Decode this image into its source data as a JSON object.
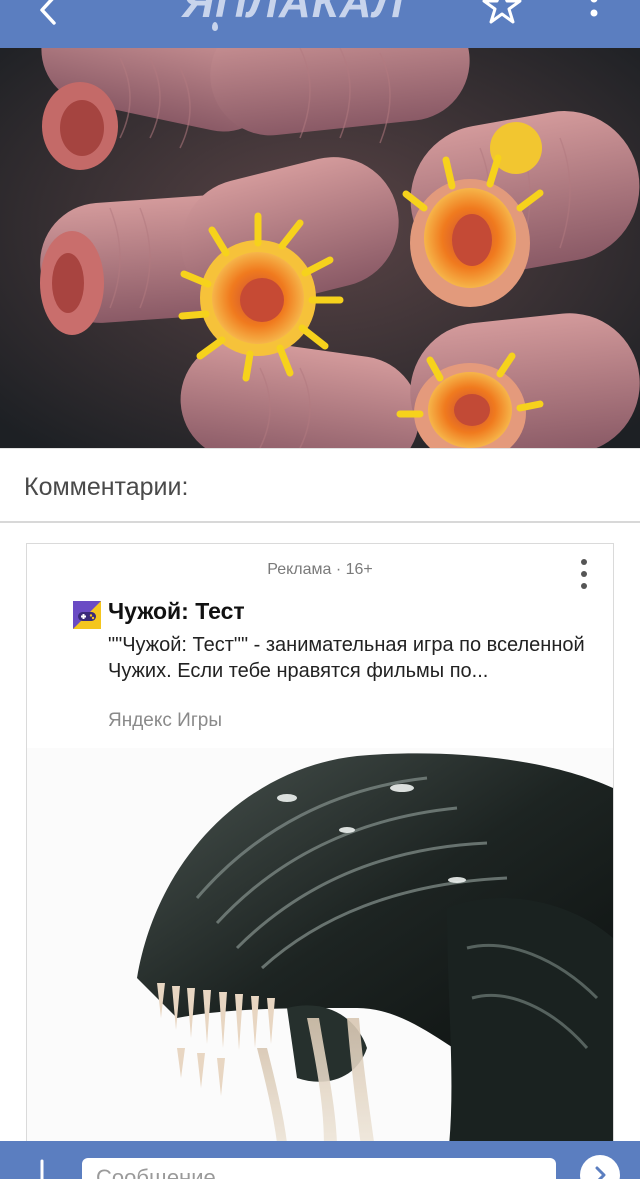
{
  "header": {
    "logo_text": "ЯПЛАКАЛ",
    "accent_color": "#5b7ec0"
  },
  "post_image": {
    "subject": "coral polyps",
    "colors": [
      "#c98a8f",
      "#f08a1c",
      "#f4d41a"
    ]
  },
  "comments": {
    "title": "Комментарии:"
  },
  "ad": {
    "label": "Реклама · 16+",
    "title": "Чужой: Тест",
    "description": "\"\"Чужой: Тест\"\" - занимательная игра по вселенной Чужих. Если тебе нравятся фильмы по...",
    "source": "Яндекс Игры",
    "icon": "gamepad-icon"
  },
  "composer": {
    "placeholder": "Сообщение"
  }
}
